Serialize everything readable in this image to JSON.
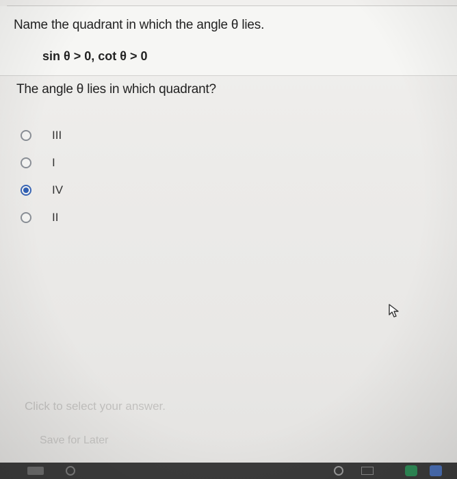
{
  "question": {
    "text": "Name the quadrant in which the angle θ lies.",
    "condition": "sin θ > 0,   cot θ > 0"
  },
  "prompt": "The angle θ lies in which quadrant?",
  "options": [
    {
      "label": "III",
      "selected": false
    },
    {
      "label": "I",
      "selected": false
    },
    {
      "label": "IV",
      "selected": true
    },
    {
      "label": "II",
      "selected": false
    }
  ],
  "hint": "Click to select your answer.",
  "save_label": "Save for Later",
  "colors": {
    "radio_border": "#8a8f96",
    "radio_selected": "#2f5fb3",
    "text": "#222222",
    "disabled_text": "#c2c1bf"
  },
  "icons": {
    "cursor": "mouse-pointer-icon"
  }
}
